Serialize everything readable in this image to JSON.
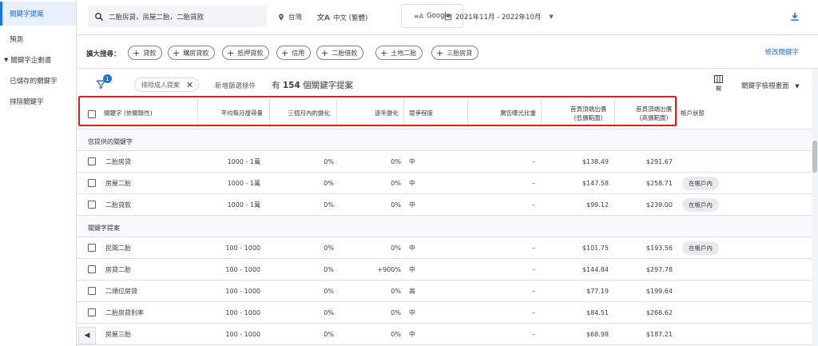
{
  "sidebar": {
    "items": [
      {
        "label": "關鍵字提案"
      },
      {
        "label": "預測"
      },
      {
        "label": "關鍵字企劃書"
      },
      {
        "label": "已儲存的關鍵字"
      },
      {
        "label": "排除關鍵字"
      }
    ]
  },
  "search": {
    "value": "二胎房貸，房屋二胎，二胎貸款",
    "location": "台灣",
    "language": "中文 (繁體)",
    "network": "Google",
    "date_range": "2021年11月 - 2022年10月"
  },
  "broaden": {
    "label": "擴大搜尋：",
    "chips": [
      "貸款",
      "購房貸款",
      "抵押貸款",
      "信用",
      "二胎借款",
      "土地二胎",
      "三胎房貸"
    ],
    "edit_link": "修改關鍵字"
  },
  "filters": {
    "badge_count": "1",
    "exclude_chip": "排除成人提案",
    "new_filter": "新增篩選條件",
    "count_prefix": "有",
    "count_number": "154",
    "count_suffix": "個關鍵字提案",
    "columns_label": "欄",
    "view_label": "關鍵字檢視畫面"
  },
  "table": {
    "headers": {
      "keyword": "關鍵字 (依關聯性)",
      "monthly": "平均每月搜尋量",
      "three_month": "三個月內的變化",
      "yoy": "逐年變化",
      "competition": "競爭程度",
      "impression_share": "廣告曝光比重",
      "bid_low_1": "首頁頂端出價",
      "bid_low_2": "(低價範圍)",
      "bid_high_1": "首頁頂端出價",
      "bid_high_2": "(高價範圍)",
      "account_status": "帳戶狀態"
    },
    "group1_label": "您提供的關鍵字",
    "group1_rows": [
      {
        "keyword": "二胎房貸",
        "monthly": "1000 - 1萬",
        "three_month": "0%",
        "yoy": "0%",
        "competition": "中",
        "impression": "–",
        "bid_low": "$138.49",
        "bid_high": "$291.67",
        "status": ""
      },
      {
        "keyword": "房屋二胎",
        "monthly": "1000 - 1萬",
        "three_month": "0%",
        "yoy": "0%",
        "competition": "中",
        "impression": "–",
        "bid_low": "$147.58",
        "bid_high": "$258.71",
        "status": "在帳戶內"
      },
      {
        "keyword": "二胎貸款",
        "monthly": "1000 - 1萬",
        "three_month": "0%",
        "yoy": "0%",
        "competition": "中",
        "impression": "–",
        "bid_low": "$99.12",
        "bid_high": "$239.00",
        "status": "在帳戶內"
      }
    ],
    "group2_label": "關鍵字提案",
    "group2_rows": [
      {
        "keyword": "民間二胎",
        "monthly": "100 - 1000",
        "three_month": "0%",
        "yoy": "0%",
        "competition": "中",
        "impression": "–",
        "bid_low": "$101.75",
        "bid_high": "$193.56",
        "status": "在帳戶內"
      },
      {
        "keyword": "房貸二胎",
        "monthly": "100 - 1000",
        "three_month": "0%",
        "yoy": "+900%",
        "competition": "中",
        "impression": "–",
        "bid_low": "$144.84",
        "bid_high": "$297.78",
        "status": ""
      },
      {
        "keyword": "二順位房貸",
        "monthly": "100 - 1000",
        "three_month": "0%",
        "yoy": "0%",
        "competition": "高",
        "impression": "–",
        "bid_low": "$77.19",
        "bid_high": "$199.64",
        "status": ""
      },
      {
        "keyword": "二胎房貸利率",
        "monthly": "100 - 1000",
        "three_month": "0%",
        "yoy": "0%",
        "competition": "中",
        "impression": "–",
        "bid_low": "$84.51",
        "bid_high": "$266.62",
        "status": ""
      },
      {
        "keyword": "房屋三胎",
        "monthly": "100 - 1000",
        "three_month": "0%",
        "yoy": "0%",
        "competition": "中",
        "impression": "–",
        "bid_low": "$68.98",
        "bid_high": "$187.21",
        "status": ""
      }
    ]
  },
  "colors": {
    "accent": "#1a73e8",
    "highlight": "#e31d1d"
  },
  "icons": [
    "search-icon",
    "location-pin-icon",
    "translate-icon",
    "network-icon",
    "calendar-icon",
    "download-icon",
    "filter-icon",
    "close-icon",
    "columns-icon",
    "caret-down-icon",
    "chevron-left-icon"
  ]
}
